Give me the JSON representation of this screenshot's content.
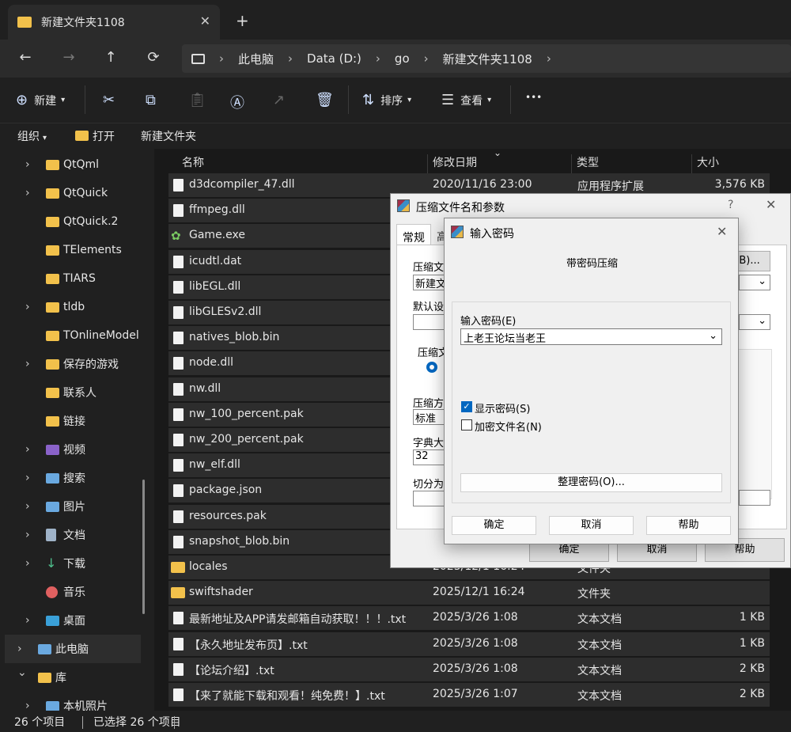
{
  "tab": {
    "title": "新建文件夹1108",
    "close": "✕",
    "new": "+"
  },
  "nav": {
    "back": "←",
    "forward": "→",
    "up": "↑",
    "refresh": "⟳",
    "chev": "›"
  },
  "address": {
    "items": [
      "此电脑",
      "Data (D:)",
      "go",
      "新建文件夹1108"
    ]
  },
  "toolbar": {
    "new": "新建",
    "sort": "排序",
    "view": "查看",
    "more": "•••"
  },
  "cmdbar": {
    "organize": "组织",
    "open": "打开",
    "new_folder": "新建文件夹"
  },
  "sidebar": [
    {
      "label": "QtQml",
      "expand": true
    },
    {
      "label": "QtQuick",
      "expand": true
    },
    {
      "label": "QtQuick.2",
      "expand": false
    },
    {
      "label": "TElements",
      "expand": false
    },
    {
      "label": "TIARS",
      "expand": false
    },
    {
      "label": "tldb",
      "expand": true
    },
    {
      "label": "TOnlineModel",
      "expand": false
    },
    {
      "label": "保存的游戏",
      "expand": true
    },
    {
      "label": "联系人",
      "expand": false
    },
    {
      "label": "链接",
      "expand": false
    },
    {
      "label": "视频",
      "expand": true
    },
    {
      "label": "搜索",
      "expand": true
    },
    {
      "label": "图片",
      "expand": true
    },
    {
      "label": "文档",
      "expand": true
    },
    {
      "label": "下载",
      "expand": true
    },
    {
      "label": "音乐",
      "expand": false
    },
    {
      "label": "桌面",
      "expand": true
    },
    {
      "label": "此电脑",
      "expand": true
    },
    {
      "label": "库",
      "expand": true
    },
    {
      "label": "本机照片",
      "expand": true
    }
  ],
  "columns": {
    "name": "名称",
    "date": "修改日期",
    "type": "类型",
    "size": "大小"
  },
  "files": [
    {
      "name": "d3dcompiler_47.dll",
      "date": "2020/11/16 23:00",
      "type": "应用程序扩展",
      "size": "3,576 KB",
      "icon": "file"
    },
    {
      "name": "ffmpeg.dll",
      "date": "",
      "type": "",
      "size": "",
      "icon": "file"
    },
    {
      "name": "Game.exe",
      "date": "",
      "type": "",
      "size": "",
      "icon": "exe"
    },
    {
      "name": "icudtl.dat",
      "date": "",
      "type": "",
      "size": "",
      "icon": "file"
    },
    {
      "name": "libEGL.dll",
      "date": "",
      "type": "",
      "size": "",
      "icon": "file"
    },
    {
      "name": "libGLESv2.dll",
      "date": "",
      "type": "",
      "size": "",
      "icon": "file"
    },
    {
      "name": "natives_blob.bin",
      "date": "",
      "type": "",
      "size": "",
      "icon": "file"
    },
    {
      "name": "node.dll",
      "date": "",
      "type": "",
      "size": "",
      "icon": "file"
    },
    {
      "name": "nw.dll",
      "date": "",
      "type": "",
      "size": "",
      "icon": "file"
    },
    {
      "name": "nw_100_percent.pak",
      "date": "",
      "type": "",
      "size": "",
      "icon": "file"
    },
    {
      "name": "nw_200_percent.pak",
      "date": "",
      "type": "",
      "size": "",
      "icon": "file"
    },
    {
      "name": "nw_elf.dll",
      "date": "",
      "type": "",
      "size": "",
      "icon": "file"
    },
    {
      "name": "package.json",
      "date": "",
      "type": "",
      "size": "",
      "icon": "file"
    },
    {
      "name": "resources.pak",
      "date": "",
      "type": "",
      "size": "",
      "icon": "file"
    },
    {
      "name": "snapshot_blob.bin",
      "date": "",
      "type": "",
      "size": "",
      "icon": "file"
    },
    {
      "name": "locales",
      "date": "2025/12/1 16:24",
      "type": "文件夹",
      "size": "",
      "icon": "folder"
    },
    {
      "name": "swiftshader",
      "date": "2025/12/1 16:24",
      "type": "文件夹",
      "size": "",
      "icon": "folder"
    },
    {
      "name": "最新地址及APP请发邮箱自动获取！！！.txt",
      "date": "2025/3/26 1:08",
      "type": "文本文档",
      "size": "1 KB",
      "icon": "file"
    },
    {
      "name": "【永久地址发布页】.txt",
      "date": "2025/3/26 1:08",
      "type": "文本文档",
      "size": "1 KB",
      "icon": "file"
    },
    {
      "name": "【论坛介绍】.txt",
      "date": "2025/3/26 1:08",
      "type": "文本文档",
      "size": "2 KB",
      "icon": "file"
    },
    {
      "name": "【来了就能下载和观看！纯免费！】.txt",
      "date": "2025/3/26 1:07",
      "type": "文本文档",
      "size": "2 KB",
      "icon": "file"
    }
  ],
  "status": {
    "count": "26 个项目",
    "selected": "已选择 26 个项目"
  },
  "dialog1": {
    "title": "压缩文件名和参数",
    "help": "?",
    "tab_general": "常规",
    "tab2": "高",
    "lbl_archive": "压缩文",
    "archive_value": "新建文",
    "lbl_default": "默认设",
    "lbl_format": "压缩文",
    "lbl_method": "压缩方",
    "method_value": "标准",
    "lbl_dict": "字典大小",
    "dict_value": "32",
    "lbl_split": "切分为分",
    "browse": "(B)...",
    "ok": "确定",
    "cancel": "取消",
    "help_btn": "帮助"
  },
  "dialog2": {
    "title": "输入密码",
    "heading": "带密码压缩",
    "label_pwd": "输入密码(E)",
    "pwd_value": "上老王论坛当老王",
    "show_pwd": "显示密码(S)",
    "encrypt_names": "加密文件名(N)",
    "organize": "整理密码(O)...",
    "ok": "确定",
    "cancel": "取消",
    "help": "帮助"
  }
}
